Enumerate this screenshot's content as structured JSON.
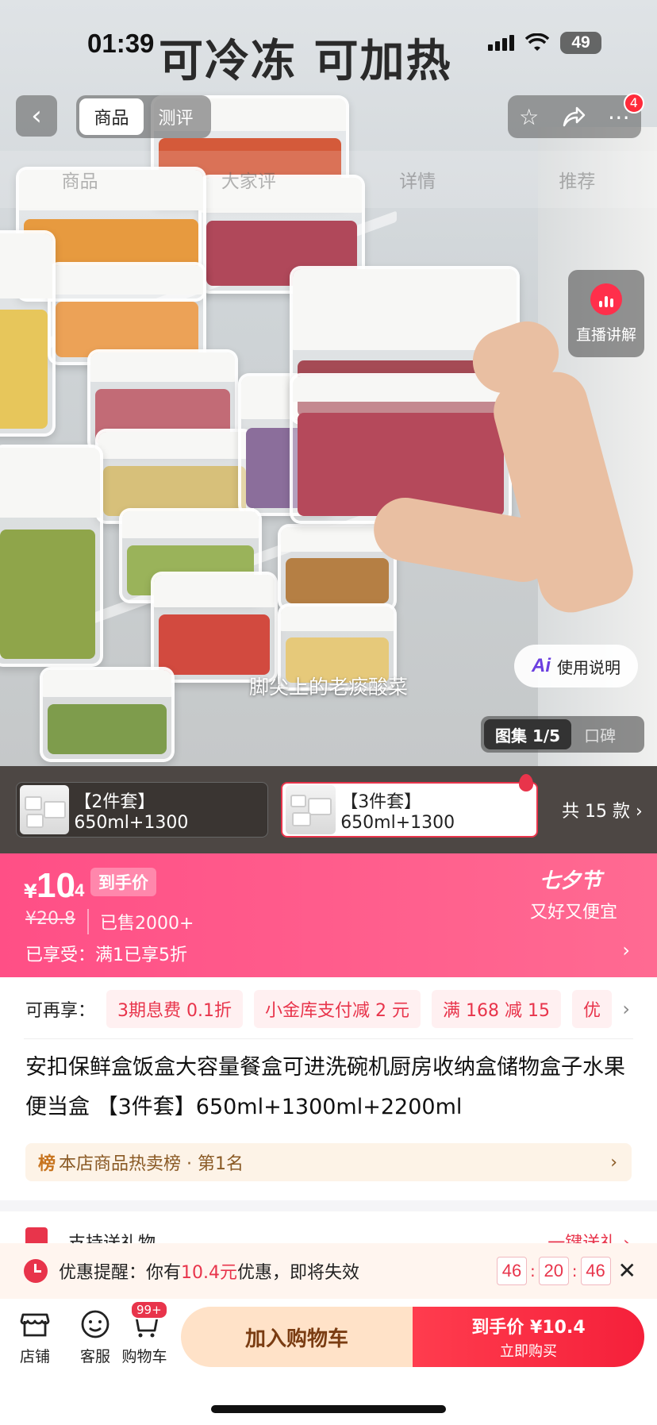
{
  "status": {
    "time": "01:39",
    "battery": "49"
  },
  "hero": {
    "headline": "可冷冻 可加热",
    "caption": "脚尖上的老痰酸菜",
    "top_tabs": [
      "商品",
      "测评"
    ],
    "section_tabs": [
      "商品",
      "大家评",
      "详情",
      "推荐"
    ],
    "more_badge": "4",
    "live_label": "直播讲解",
    "usage_label": "使用说明",
    "usage_ai": "Ai",
    "gallery_active": "图集 1/5",
    "gallery_other": "口碑"
  },
  "variants": {
    "items": [
      "【2件套】650ml+1300",
      "【3件套】650ml+1300"
    ],
    "more": "共 15 款 ›"
  },
  "price": {
    "currency": "¥",
    "integer": "10",
    "decimal": ".4",
    "tag": "到手价",
    "original": "¥20.8",
    "sold": "已售2000+",
    "enjoyed": "已享受：满1已享5折",
    "festival": "七夕节",
    "festival_sub": "又好又便宜"
  },
  "coupons": {
    "label": "可再享：",
    "items": [
      "3期息费 0.1折",
      "小金库支付减 2 元",
      "满 168 减 15",
      "优"
    ]
  },
  "product": {
    "title": "安扣保鲜盒饭盒大容量餐盒可进洗碗机厨房收纳盒储物盒子水果便当盒 【3件套】650ml+1300ml+2200ml",
    "rank_mark": "榜",
    "rank": "本店商品热卖榜 · 第1名"
  },
  "gift": {
    "label": "支持送礼物",
    "action": "一键送礼 ›"
  },
  "reminder": {
    "prefix": "优惠提醒：你有",
    "amount": "10.4元",
    "suffix": "优惠，即将失效",
    "timer": [
      "46",
      "20",
      "46"
    ]
  },
  "bottom": {
    "shop": "店铺",
    "service": "客服",
    "cart": "购物车",
    "cart_badge": "99+",
    "add_cart": "加入购物车",
    "buy_price": "到手价 ¥10.4",
    "buy_label": "立即购买"
  }
}
